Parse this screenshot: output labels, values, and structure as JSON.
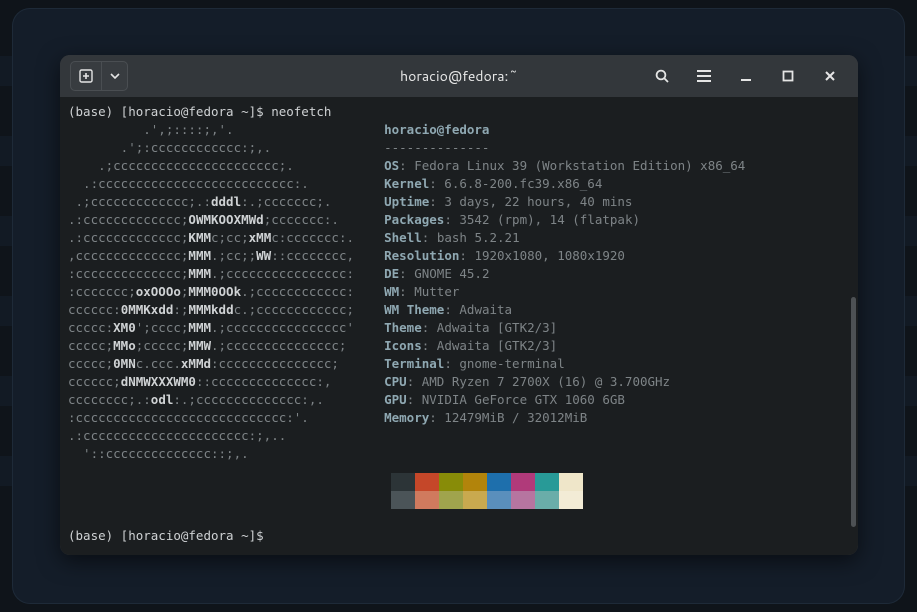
{
  "window": {
    "title": "horacio@fedora:~"
  },
  "prompt1": "(base) [horacio@fedora ~]$ ",
  "command": "neofetch",
  "prompt2": "(base) [horacio@fedora ~]$ ",
  "logo_lines": [
    "          .',;::::;,'.",
    "       .';:cccccccccccc:;,.",
    "    .;cccccccccccccccccccccc;.",
    "  .:cccccccccccccccccccccccccc:.",
    " .;ccccccccccccc;.:dddl:.;ccccccc;.",
    ".:ccccccccccccc;OWMKOOXMWd;ccccccc:.",
    ".:ccccccccccccc;KMMc;cc;xMMc:ccccccc:.",
    ",cccccccccccccc;MMM.;cc;;WW::cccccccc,",
    ":cccccccccccccc;MMM.;cccccccccccccccc:",
    ":ccccccc;oxOOOo;MMM0OOk.;cccccccccccc:",
    "cccccc:0MMKxdd:;MMMkddc.;cccccccccccc;",
    "ccccc:XM0';cccc;MMM.;cccccccccccccccc'",
    "ccccc;MMo;ccccc;MMW.;ccccccccccccccc;",
    "ccccc;0MNc.ccc.xMMd:ccccccccccccccc;",
    "cccccc;dNMWXXXWM0::cccccccccccccc:,",
    "cccccccc;.:odl:.;cccccccccccccc:,.",
    ":cccccccccccccccccccccccccccc:'.",
    ".:cccccccccccccccccccccc:;,..",
    "  '::cccccccccccccc::;,."
  ],
  "header": {
    "userhost": "horacio@fedora",
    "separator": "--------------"
  },
  "info": [
    {
      "label": "OS",
      "value": "Fedora Linux 39 (Workstation Edition) x86_64"
    },
    {
      "label": "Kernel",
      "value": "6.6.8-200.fc39.x86_64"
    },
    {
      "label": "Uptime",
      "value": "3 days, 22 hours, 40 mins"
    },
    {
      "label": "Packages",
      "value": "3542 (rpm), 14 (flatpak)"
    },
    {
      "label": "Shell",
      "value": "bash 5.2.21"
    },
    {
      "label": "Resolution",
      "value": "1920x1080, 1080x1920"
    },
    {
      "label": "DE",
      "value": "GNOME 45.2"
    },
    {
      "label": "WM",
      "value": "Mutter"
    },
    {
      "label": "WM Theme",
      "value": "Adwaita"
    },
    {
      "label": "Theme",
      "value": "Adwaita [GTK2/3]"
    },
    {
      "label": "Icons",
      "value": "Adwaita [GTK2/3]"
    },
    {
      "label": "Terminal",
      "value": "gnome-terminal"
    },
    {
      "label": "CPU",
      "value": "AMD Ryzen 7 2700X (16) @ 3.700GHz"
    },
    {
      "label": "GPU",
      "value": "NVIDIA GeForce GTX 1060 6GB"
    },
    {
      "label": "Memory",
      "value": "12479MiB / 32012MiB"
    }
  ],
  "swatches_row1": [
    "#2c3437",
    "#c54729",
    "#888c08",
    "#b2840b",
    "#1e6fac",
    "#b03a7a",
    "#289a97",
    "#efe6c9"
  ],
  "swatches_row2": [
    "#4b5458",
    "#d07a5e",
    "#a0a44d",
    "#c9a94f",
    "#5a8fbc",
    "#b675a0",
    "#6aada9",
    "#f3ecd6"
  ]
}
